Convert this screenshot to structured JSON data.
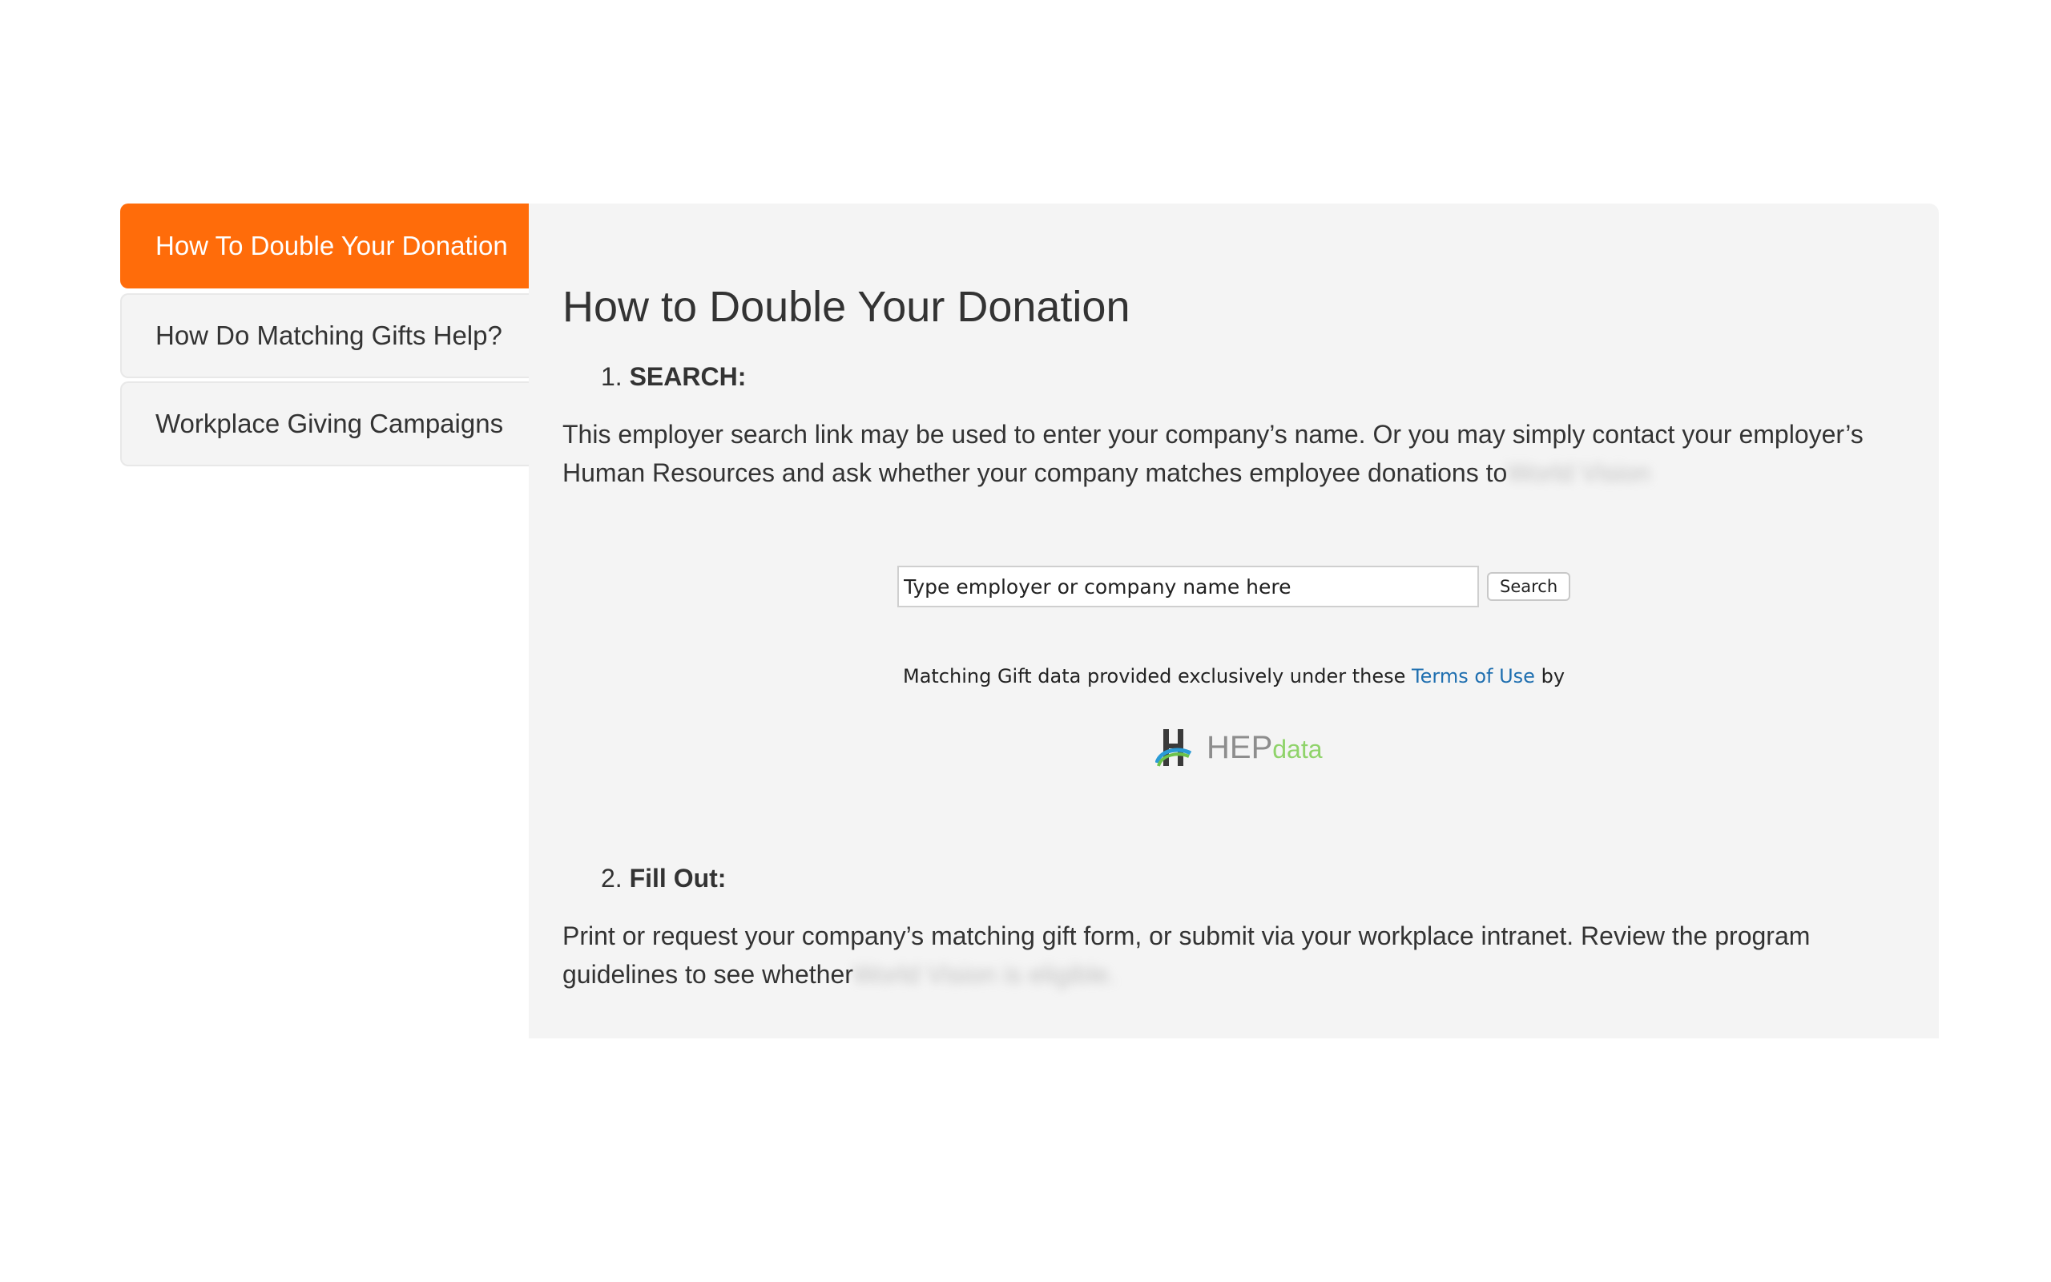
{
  "sidebar": {
    "tabs": [
      {
        "label": "How To Double Your Donation",
        "active": true
      },
      {
        "label": "How Do Matching Gifts Help?",
        "active": false
      },
      {
        "label": "Workplace Giving Campaigns",
        "active": false
      }
    ]
  },
  "main": {
    "title": "How to Double Your Donation",
    "step1": {
      "number": "1.",
      "label": "SEARCH:"
    },
    "step1_text": "This employer search link may be used to enter your company’s name. Or you may simply contact your employer’s Human Resources and ask whether your company matches employee donations to",
    "step1_blurred": "World Vision",
    "search": {
      "placeholder": "Type employer or company name here",
      "button_label": "Search"
    },
    "terms": {
      "prefix": "Matching Gift data provided exclusively under these",
      "link": "Terms of Use",
      "suffix": "by"
    },
    "logo": {
      "brand": "HEP",
      "suffix": "data"
    },
    "step2": {
      "number": "2.",
      "label": "Fill Out:"
    },
    "step2_text": "Print or request your company’s matching gift form, or submit via your workplace intranet. Review the program guidelines to see whether",
    "step2_blurred": "World Vision is eligible."
  },
  "colors": {
    "accent": "#ff6c0a",
    "panel_bg": "#f4f4f4",
    "link": "#1f6fb0",
    "logo_green": "#8fd36a"
  }
}
